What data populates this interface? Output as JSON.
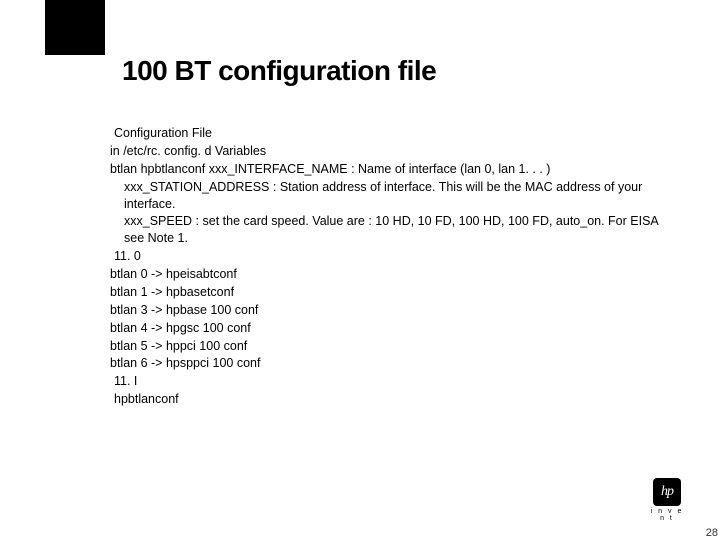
{
  "title": "100 BT configuration file",
  "lines": [
    {
      "text": "Configuration File",
      "cls": "lead"
    },
    {
      "text": "in /etc/rc. config. d Variables",
      "cls": ""
    },
    {
      "text": "btlan hpbtlanconf  xxx_INTERFACE_NAME : Name of interface (lan 0, lan 1. . . )",
      "cls": ""
    },
    {
      "text": "xxx_STATION_ADDRESS : Station address of interface. This will be the MAC address of your interface.",
      "cls": "indent"
    },
    {
      "text": "xxx_SPEED : set the card speed. Value are : 10 HD, 10 FD, 100 HD, 100 FD, auto_on. For EISA see Note 1.",
      "cls": "indent"
    },
    {
      "text": "11. 0",
      "cls": "lead"
    },
    {
      "text": "btlan 0 -> hpeisabtconf",
      "cls": ""
    },
    {
      "text": "btlan 1 -> hpbasetconf",
      "cls": ""
    },
    {
      "text": "btlan 3 -> hpbase 100 conf",
      "cls": ""
    },
    {
      "text": "btlan 4 -> hpgsc 100 conf",
      "cls": ""
    },
    {
      "text": "btlan 5 -> hppci 100 conf",
      "cls": ""
    },
    {
      "text": "btlan 6 -> hpsppci 100 conf",
      "cls": ""
    },
    {
      "text": "11. I",
      "cls": "lead"
    },
    {
      "text": "hpbtlanconf",
      "cls": "lead"
    }
  ],
  "logo": {
    "mark": "hp",
    "tagline": "i n v e n t"
  },
  "page_number": "28"
}
